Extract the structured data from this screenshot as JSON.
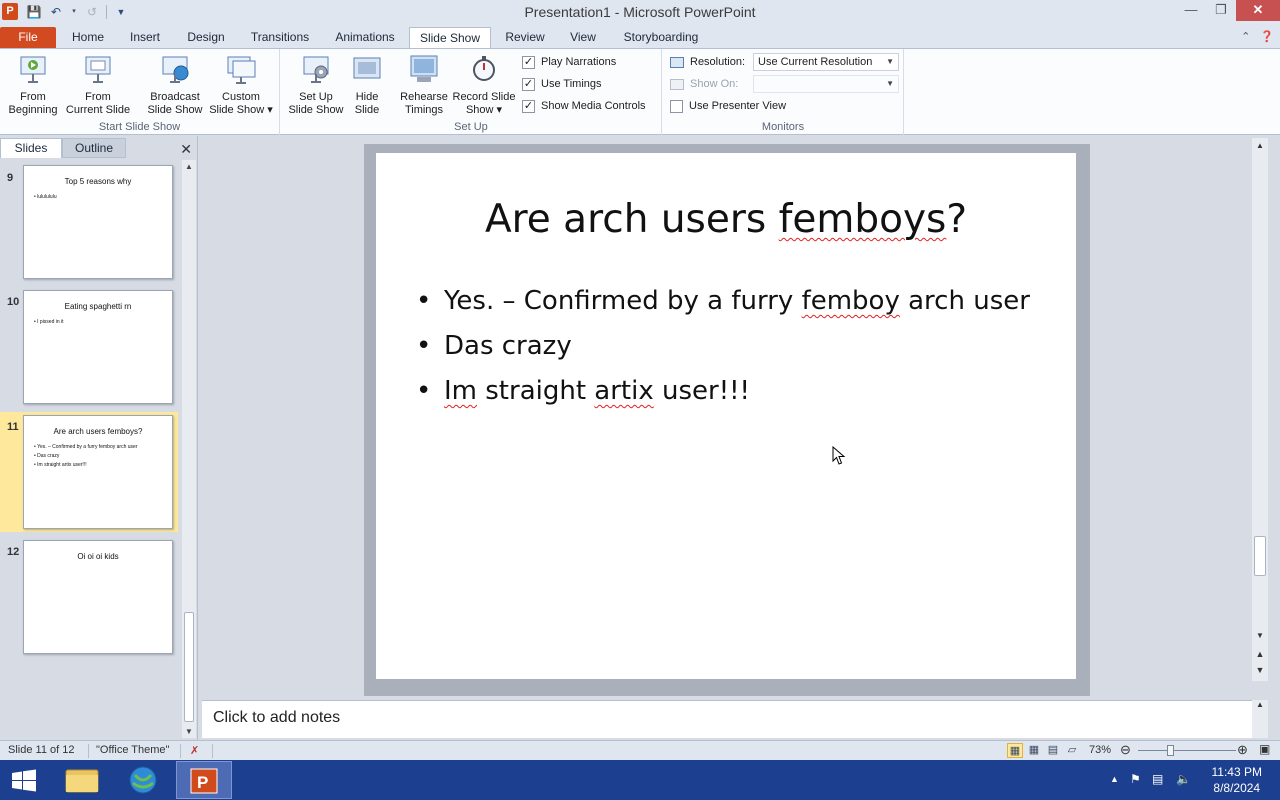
{
  "window": {
    "title": "Presentation1  -  Microsoft PowerPoint",
    "app_icon_letter": "P"
  },
  "ribbon_tabs": [
    {
      "label": "File"
    },
    {
      "label": "Home"
    },
    {
      "label": "Insert"
    },
    {
      "label": "Design"
    },
    {
      "label": "Transitions"
    },
    {
      "label": "Animations"
    },
    {
      "label": "Slide Show"
    },
    {
      "label": "Review"
    },
    {
      "label": "View"
    },
    {
      "label": "Storyboarding"
    }
  ],
  "active_tab": "Slide Show",
  "ribbon": {
    "start_group_label": "Start Slide Show",
    "from_beginning": [
      "From",
      "Beginning"
    ],
    "from_current": [
      "From",
      "Current Slide"
    ],
    "broadcast": [
      "Broadcast",
      "Slide Show"
    ],
    "custom": [
      "Custom",
      "Slide Show ▾"
    ],
    "setup_group_label": "Set Up",
    "setup": [
      "Set Up",
      "Slide Show"
    ],
    "hide": [
      "Hide",
      "Slide"
    ],
    "rehearse": [
      "Rehearse",
      "Timings"
    ],
    "record": [
      "Record Slide",
      "Show ▾"
    ],
    "play_narrations": {
      "label": "Play Narrations",
      "checked": true
    },
    "use_timings": {
      "label": "Use Timings",
      "checked": true
    },
    "show_media_controls": {
      "label": "Show Media Controls",
      "checked": true
    },
    "monitors_group_label": "Monitors",
    "resolution_label": "Resolution:",
    "resolution_value": "Use Current Resolution",
    "show_on_label": "Show On:",
    "use_presenter_view": {
      "label": "Use Presenter View",
      "checked": false
    }
  },
  "left_panel": {
    "tabs": [
      "Slides",
      "Outline"
    ],
    "close_glyph": "✕",
    "thumbnails": [
      {
        "number": "9",
        "title": "Top 5 reasons why",
        "bullets": [
          "lululululu"
        ]
      },
      {
        "number": "10",
        "title": "Eating spaghetti rn",
        "bullets": [
          "I pissed in it"
        ]
      },
      {
        "number": "11",
        "title": "Are arch users femboys?",
        "bullets": [
          "Yes. – Confirmed by a furry femboy arch user",
          "Das crazy",
          "Im straight artix user!!!"
        ],
        "selected": true
      },
      {
        "number": "12",
        "title": "Oi oi oi kids",
        "bullets": []
      }
    ]
  },
  "slide": {
    "title_parts": [
      "Are arch users ",
      "femboys",
      "?"
    ],
    "bullet1": [
      "Yes. – Confirmed by a furry ",
      "femboy",
      " arch user"
    ],
    "bullet2": "Das crazy",
    "bullet3": [
      "Im",
      " straight ",
      "artix",
      " user!!!"
    ]
  },
  "notes": {
    "placeholder": "Click to add notes"
  },
  "status_bar": {
    "slide_indicator": "Slide 11 of 12",
    "theme": "\"Office Theme\"",
    "zoom": "73%"
  },
  "taskbar": {
    "time": "11:43 PM",
    "date": "8/8/2024"
  },
  "colors": {
    "file_tab": "#d24a20",
    "selection_highlight": "#fde89b",
    "taskbar": "#1c3f8f",
    "close_button": "#c75050"
  }
}
